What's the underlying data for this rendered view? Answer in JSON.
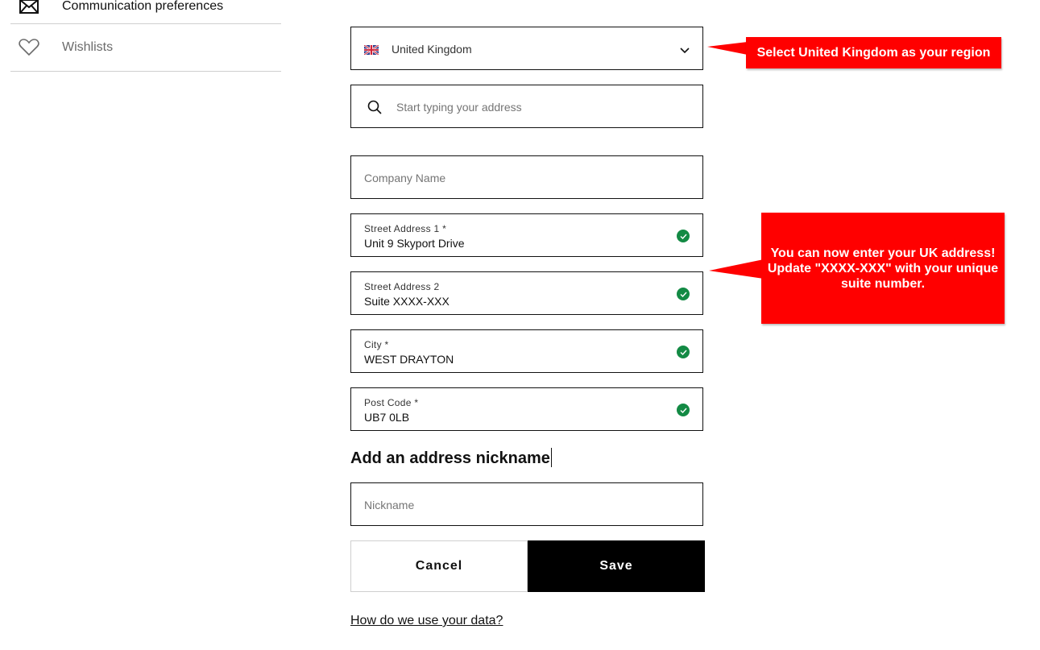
{
  "sidebar": {
    "items": [
      {
        "label": "Communication preferences",
        "icon": "envelope-icon"
      },
      {
        "label": "Wishlists",
        "icon": "heart-icon"
      }
    ]
  },
  "form": {
    "country": {
      "value": "United Kingdom",
      "flag": "uk-flag-icon"
    },
    "search": {
      "placeholder": "Start typing your address"
    },
    "company": {
      "placeholder": "Company Name"
    },
    "street1": {
      "label": "Street Address 1 *",
      "value": "Unit 9 Skyport Drive",
      "valid": true
    },
    "street2": {
      "label": "Street Address 2",
      "value": "Suite XXXX-XXX",
      "valid": true
    },
    "city": {
      "label": "City *",
      "value": "WEST DRAYTON",
      "valid": true
    },
    "postcode": {
      "label": "Post Code *",
      "value": "UB7 0LB",
      "valid": true
    },
    "nickname_heading": "Add an address nickname",
    "nickname": {
      "placeholder": "Nickname"
    },
    "cancel_label": "Cancel",
    "save_label": "Save",
    "data_link": "How do we use your data?"
  },
  "annotations": {
    "callout_region": "Select United Kingdom as your region",
    "callout_address_line1": "You can now enter your UK address!",
    "callout_address_line2": "Update \"XXXX-XXX\" with your unique",
    "callout_address_line3": "suite number."
  },
  "colors": {
    "callout": "#ff0000",
    "valid_check": "#138a44",
    "save_button": "#000000"
  }
}
